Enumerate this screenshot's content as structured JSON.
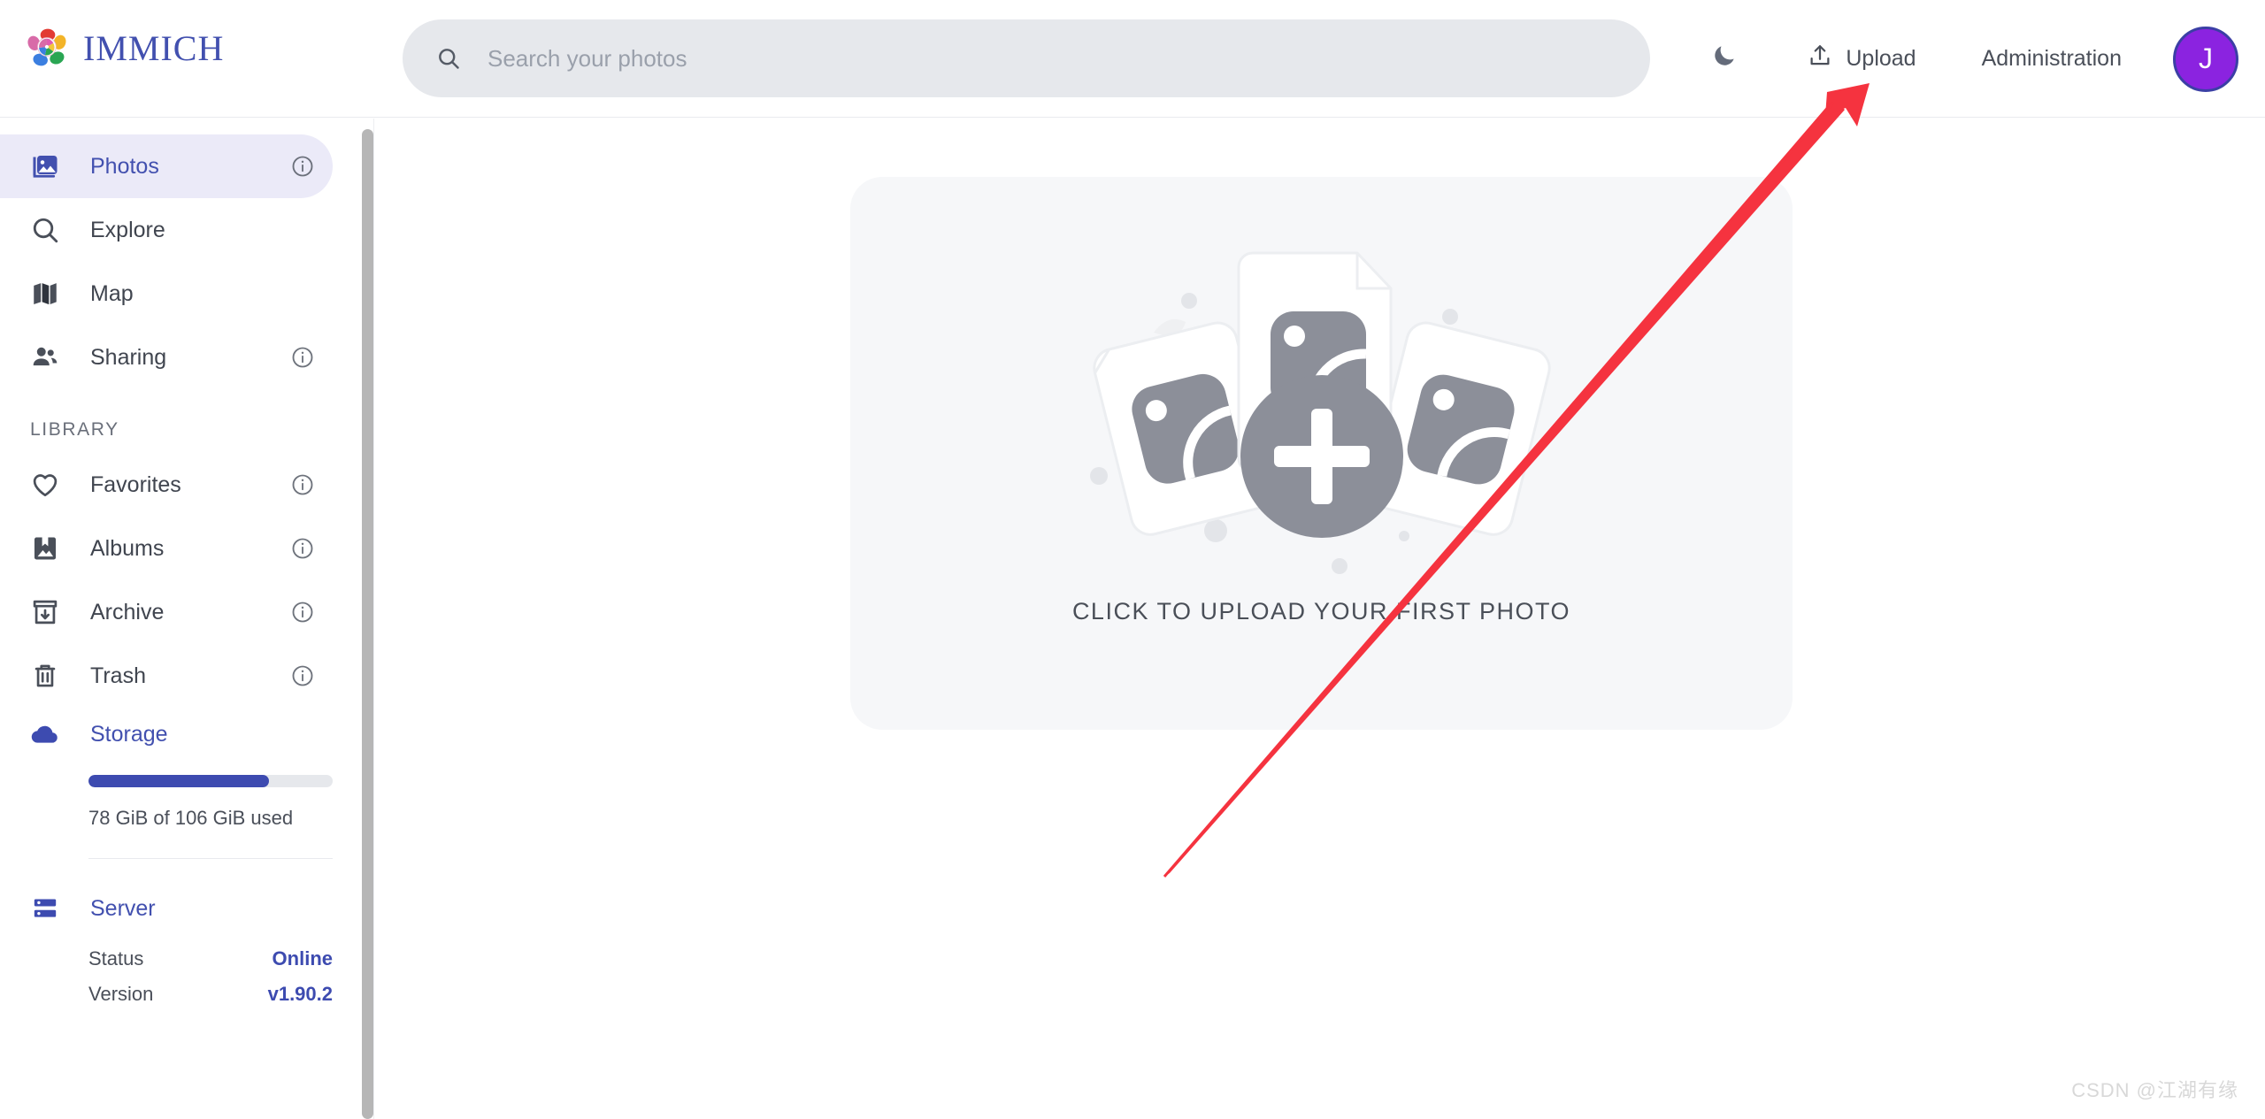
{
  "brand": {
    "name": "IMMICH",
    "logo_icon": "immich-flower-logo"
  },
  "search": {
    "placeholder": "Search your photos",
    "value": "",
    "icon": "search-icon"
  },
  "header": {
    "theme_toggle": {
      "icon": "moon-icon",
      "label": ""
    },
    "upload": {
      "label": "Upload",
      "icon": "upload-icon"
    },
    "administration": {
      "label": "Administration"
    },
    "avatar": {
      "initial": "J",
      "bg_color": "#8b23e0",
      "border_color": "#3b3fa5"
    }
  },
  "sidebar": {
    "primary": [
      {
        "label": "Photos",
        "icon": "photos-icon",
        "active": true,
        "has_info": true
      },
      {
        "label": "Explore",
        "icon": "explore-icon",
        "active": false,
        "has_info": false
      },
      {
        "label": "Map",
        "icon": "map-icon",
        "active": false,
        "has_info": false
      },
      {
        "label": "Sharing",
        "icon": "sharing-icon",
        "active": false,
        "has_info": true
      }
    ],
    "library_label": "LIBRARY",
    "library": [
      {
        "label": "Favorites",
        "icon": "heart-icon",
        "has_info": true
      },
      {
        "label": "Albums",
        "icon": "albums-icon",
        "has_info": true
      },
      {
        "label": "Archive",
        "icon": "archive-icon",
        "has_info": true
      },
      {
        "label": "Trash",
        "icon": "trash-icon",
        "has_info": true
      }
    ],
    "storage": {
      "label": "Storage",
      "icon": "cloud-icon",
      "used_text": "78 GiB of 106 GiB used",
      "percent": 74
    },
    "server": {
      "label": "Server",
      "icon": "server-icon",
      "rows": [
        {
          "key": "Status",
          "value": "Online"
        },
        {
          "key": "Version",
          "value": "v1.90.2"
        }
      ]
    }
  },
  "main": {
    "upload_panel": {
      "caption": "CLICK TO UPLOAD YOUR FIRST PHOTO",
      "illustration": "photo-cards-with-plus-illustration"
    }
  },
  "annotation": {
    "arrow": "red-arrow-pointing-to-upload"
  },
  "watermark": {
    "text": "CSDN @江湖有缘"
  },
  "colors": {
    "accent_indigo": "#4250af",
    "storage_fill": "#3d4bb0",
    "active_pill": "#ebeaf8",
    "panel_bg": "#f6f7f9",
    "annotation_red": "#f5333f"
  }
}
